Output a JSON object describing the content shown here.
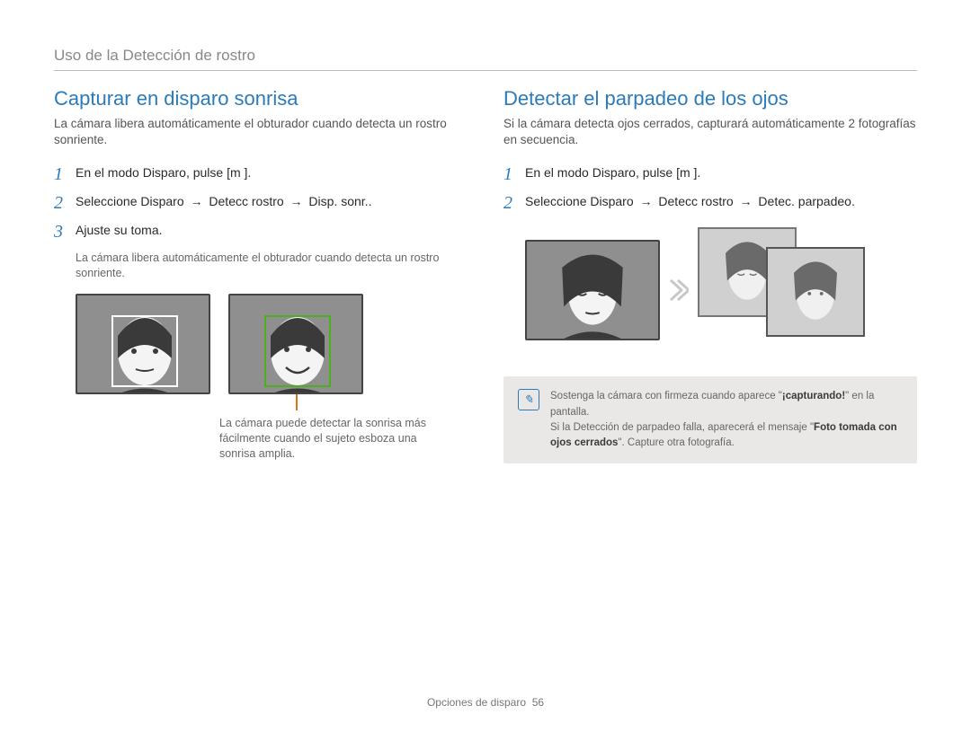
{
  "header": "Uso de la Detección de rostro",
  "left": {
    "title": "Capturar en disparo sonrisa",
    "lead": "La cámara libera automáticamente el obturador cuando detecta un rostro sonriente.",
    "step1": "En el modo Disparo, pulse [m       ].",
    "step2_pre": "Seleccione Disparo ",
    "step2_a": "→",
    "step2_mid": " Detecc rostro ",
    "step2_end": " Disp. sonr..",
    "step3": "Ajuste su toma.",
    "step3_sub": "La cámara libera automáticamente el obturador cuando detecta un rostro sonriente.",
    "caption": "La cámara puede detectar la sonrisa más fácilmente cuando el sujeto esboza una sonrisa amplia."
  },
  "right": {
    "title": "Detectar el parpadeo de los ojos",
    "lead": "Si la cámara detecta ojos cerrados, capturará automáticamente 2 fotografías en secuencia.",
    "step1": "En el modo Disparo, pulse [m       ].",
    "step2_pre": "Seleccione Disparo ",
    "step2_a": "→",
    "step2_mid": " Detecc rostro ",
    "step2_end": " Detec. parpadeo.",
    "note_l1a": "Sostenga la cámara con firmeza cuando aparece \"",
    "note_l1b": "¡capturando!",
    "note_l1c": "\" en la pantalla.",
    "note_l2a": "Si la Detección de parpadeo falla, aparecerá el mensaje \"",
    "note_l2b": "Foto tomada con ojos cerrados",
    "note_l2c": "\". Capture otra fotografía."
  },
  "footer_label": "Opciones de disparo",
  "footer_page": "56"
}
